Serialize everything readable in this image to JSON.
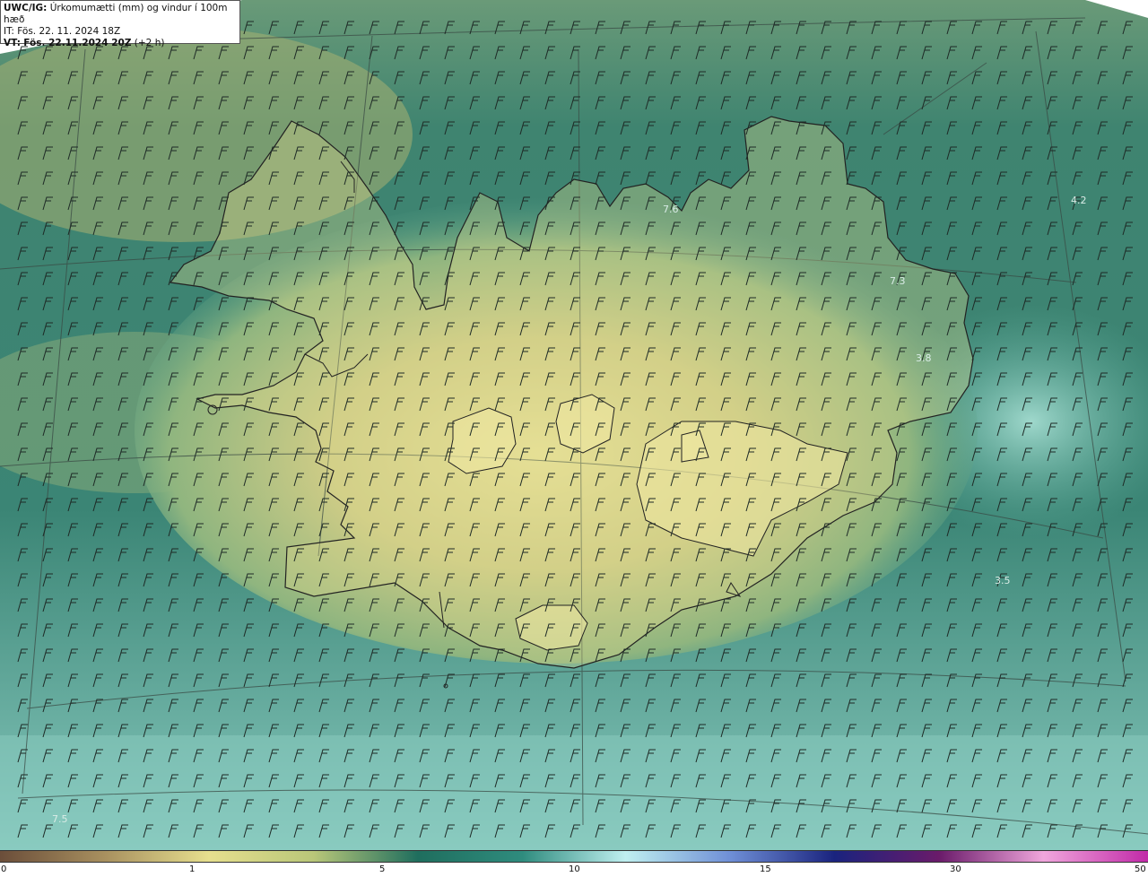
{
  "header": {
    "model": "UWC/IG:",
    "field": "Úrkomumætti (mm) og vindur í 100m hæð",
    "it_line": "IT: Fös. 22. 11. 2024 18Z",
    "vt_prefix": "VT:",
    "vt_main": "Fös. 22.11.2024 20Z",
    "vt_offset": "(+2 h)"
  },
  "map_labels": [
    "4.2",
    "7.6",
    "7.3",
    "3.8",
    "3.5",
    "7.5"
  ],
  "colorbar": {
    "ticks": [
      "0",
      "1",
      "5",
      "10",
      "15",
      "30",
      "50"
    ],
    "colors": [
      "#6b4e3a",
      "#a8905f",
      "#e6df8e",
      "#b9c779",
      "#1f6e5e",
      "#2f8c7e",
      "#bfeff0",
      "#6f8fd6",
      "#1a237e",
      "#6a1b6a",
      "#f0a6dc",
      "#c12aa8"
    ]
  },
  "palette": {
    "ocean_dark": "#2e7566",
    "ocean_mid": "#4f9a86",
    "ocean_light": "#8ccfc3",
    "land_high": "#e8e196",
    "land_mid": "#b9c27b",
    "coast": "#2a2a2a"
  }
}
